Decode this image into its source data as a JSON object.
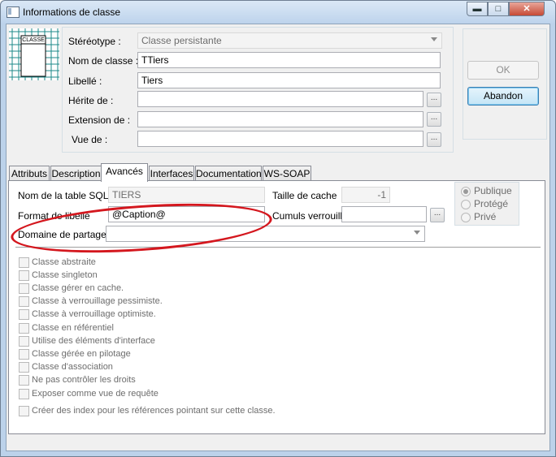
{
  "window": {
    "title": "Informations de classe",
    "icons": {
      "app": "window-app-icon",
      "minimize": "minimize-icon",
      "maximize": "maximize-icon",
      "close": "close-icon"
    },
    "controls": {
      "minimize": "▬",
      "maximize": "□",
      "close": "✕"
    }
  },
  "header": {
    "class_icon_label": "CLASSE",
    "fields": {
      "stereotype": {
        "label": "Stéréotype :",
        "value": "Classe persistante"
      },
      "class_name": {
        "label": "Nom de classe :",
        "value": "TTiers"
      },
      "caption": {
        "label": "Libellé :",
        "value": "Tiers"
      },
      "inherits": {
        "label": "Hérite de :",
        "value": ""
      },
      "extension": {
        "label": "Extension de :",
        "value": ""
      },
      "view": {
        "label": "Vue de :",
        "value": ""
      }
    },
    "ellipsis": "..."
  },
  "buttons": {
    "ok": "OK",
    "cancel": "Abandon"
  },
  "tabs": [
    {
      "label": "Attributs"
    },
    {
      "label": "Description"
    },
    {
      "label": "Avancés"
    },
    {
      "label": "Interfaces"
    },
    {
      "label": "Documentation"
    },
    {
      "label": "WS-SOAP"
    }
  ],
  "advanced": {
    "sql_table": {
      "label": "Nom de la table SQL",
      "value": "TIERS"
    },
    "caption_format": {
      "label": "Format de libellé",
      "value": "@Caption@"
    },
    "sharing_domain": {
      "label": "Domaine de partage :",
      "value": ""
    },
    "cache_size": {
      "label": "Taille de cache",
      "value": "-1"
    },
    "lock_cumul": {
      "label": "Cumuls verrouillé",
      "value": ""
    },
    "visibility": {
      "options": [
        "Publique",
        "Protégé",
        "Privé"
      ],
      "selected": "Publique"
    },
    "checkboxes": [
      "Classe abstraite",
      "Classe singleton",
      "Classe gérer en cache.",
      "Classe à verrouillage pessimiste.",
      "Classe à verrouillage optimiste.",
      "Classe en référentiel",
      "Utilise des éléments d'interface",
      "Classe gérée en pilotage",
      "Classe d'association",
      "Ne pas contrôler les droits",
      "Exposer comme vue de requête",
      "Créer des index pour les références pointant sur cette classe."
    ]
  },
  "colors": {
    "annotation": "#d4171e",
    "title_gradient_top": "#dbe8f6"
  }
}
